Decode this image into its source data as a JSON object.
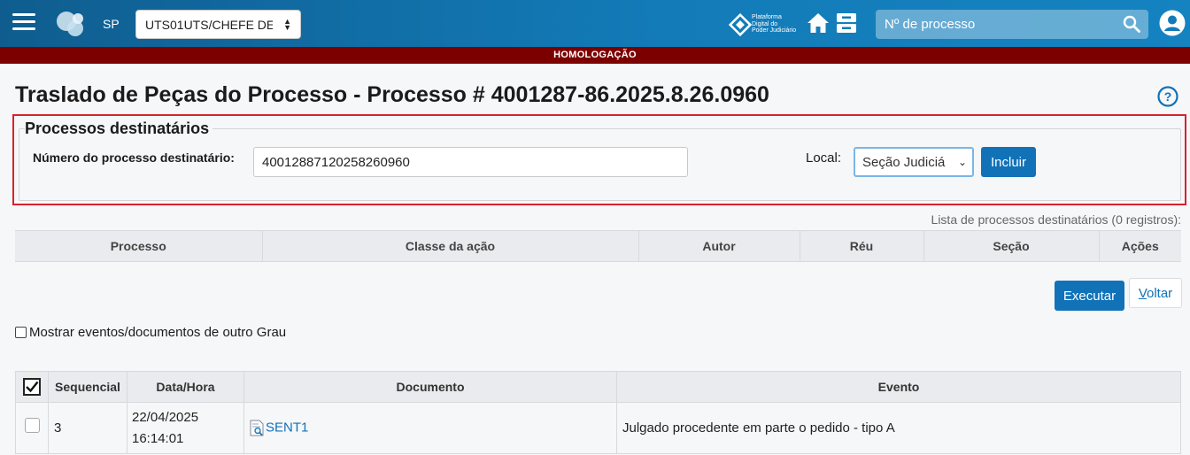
{
  "header": {
    "state": "SP",
    "unit_select_value": "UTS01UTS/CHEFE DE",
    "platform_logo_text": "Plataforma\nDigital do\nPoder Judiciário",
    "search_placeholder": "Nº de processo"
  },
  "banner": {
    "environment": "HOMOLOGAÇÃO"
  },
  "page": {
    "title": "Traslado de Peças do Processo - Processo # 4001287-86.2025.8.26.0960"
  },
  "destinatarios": {
    "legend": "Processos destinatários",
    "numero_label": "Número do processo destinatário:",
    "numero_value": "40012887120258260960",
    "local_label": "Local:",
    "local_value": "Seção Judiciá",
    "incluir_label": "Incluir"
  },
  "dest_list": {
    "caption": "Lista de processos destinatários (0 registros):",
    "columns": [
      "Processo",
      "Classe da ação",
      "Autor",
      "Réu",
      "Seção",
      "Ações"
    ]
  },
  "actions": {
    "executar": "Executar",
    "voltar_prefix": "V",
    "voltar_rest": "oltar"
  },
  "options": {
    "outro_grau": "Mostrar eventos/documentos de outro Grau"
  },
  "events": {
    "columns": [
      "Sequencial",
      "Data/Hora",
      "Documento",
      "Evento"
    ],
    "rows": [
      {
        "seq": "3",
        "date": "22/04/2025",
        "time": "16:14:01",
        "doc": "SENT1",
        "evento": "Julgado procedente em parte o pedido - tipo A"
      }
    ]
  },
  "colors": {
    "topbar": "#137bb8",
    "banner": "#7d0000",
    "primary_button": "#1172b8",
    "highlight_outline": "#d9222a"
  }
}
